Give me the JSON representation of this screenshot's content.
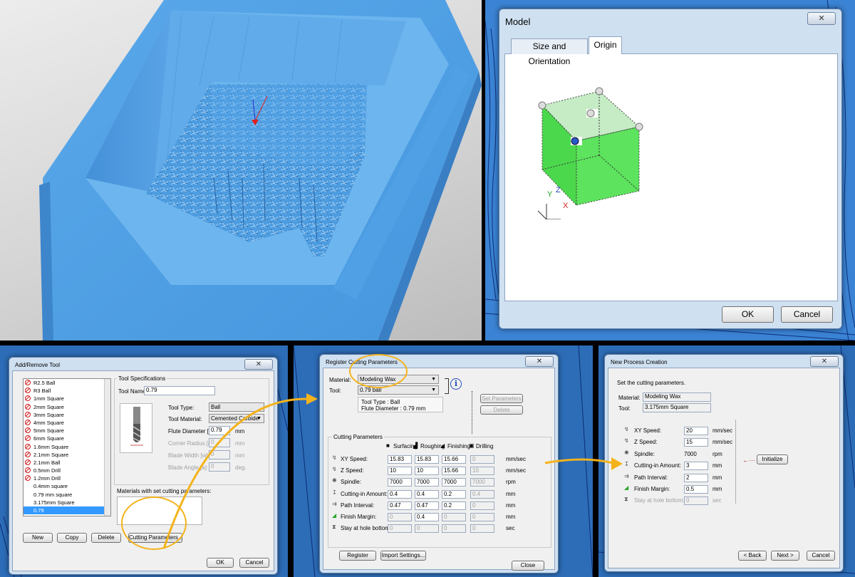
{
  "model_dialog": {
    "title": "Model",
    "close_icon": "✕",
    "tabs": [
      "Size and Orientation",
      "Origin"
    ],
    "axis_labels": {
      "x": "X",
      "y": "Y",
      "z": "Z"
    },
    "ok_label": "OK",
    "cancel_label": "Cancel"
  },
  "add_remove_tool": {
    "title": "Add/Remove Tool",
    "close_icon": "✕",
    "tools": [
      {
        "name": "R2.5 Ball",
        "disabled": true
      },
      {
        "name": "R3 Ball",
        "disabled": true
      },
      {
        "name": "1mm Square",
        "disabled": true
      },
      {
        "name": "2mm Square",
        "disabled": true
      },
      {
        "name": "3mm Square",
        "disabled": true
      },
      {
        "name": "4mm Square",
        "disabled": true
      },
      {
        "name": "5mm Square",
        "disabled": true
      },
      {
        "name": "6mm Square",
        "disabled": true
      },
      {
        "name": "1.6mm Square",
        "disabled": true
      },
      {
        "name": "2.1mm Square",
        "disabled": true
      },
      {
        "name": "2.1mm Ball",
        "disabled": true
      },
      {
        "name": "0.5mm Drill",
        "disabled": true
      },
      {
        "name": "1.2mm Drill",
        "disabled": true
      },
      {
        "name": "0.4mm square",
        "disabled": false
      },
      {
        "name": "0.79 mm square",
        "disabled": false
      },
      {
        "name": "3.175mm Square",
        "disabled": false
      },
      {
        "name": "0.79",
        "disabled": false,
        "selected": true
      }
    ],
    "spec_group": "Tool Specifications",
    "tool_name_label": "Tool Name:",
    "tool_name_value": "0.79",
    "tool_type_label": "Tool Type:",
    "tool_type_value": "Ball",
    "tool_material_label": "Tool Material:",
    "tool_material_value": "Cemented Carbide",
    "flute_diameter_label": "Flute Diameter [d]:",
    "flute_diameter_value": "0.79",
    "corner_radius_label": "Corner Radius [r]:",
    "corner_radius_value": "0",
    "blade_width_label": "Blade Width [w]:",
    "blade_width_value": "0",
    "blade_angle_label": "Blade Angle [a]:",
    "blade_angle_value": "0",
    "unit_mm": "mm",
    "unit_deg": "deg.",
    "materials_label": "Materials with set cutting parameters:",
    "new_label": "New",
    "copy_label": "Copy",
    "delete_label": "Delete",
    "cutting_params_label": "Cutting Parameters...",
    "ok_label": "OK",
    "cancel_label": "Cancel"
  },
  "register_cutting": {
    "title": "Register Cutting Parameters",
    "close_icon": "✕",
    "material_label": "Material:",
    "material_value": "Modeling Wax",
    "tool_label": "Tool:",
    "tool_value": "0.79 ball",
    "info_icon": "i",
    "tool_type_text": "Tool Type : Ball",
    "flute_text": "Flute Diameter : 0.79 mm",
    "set_params_label": "Set Parameters",
    "delete_label": "Delete",
    "group_label": "Cutting Parameters",
    "columns": [
      "Surfacing",
      "Roughing",
      "Finishing",
      "Drilling"
    ],
    "rows": [
      {
        "label": "XY Speed:",
        "values": [
          "15.83",
          "15.83",
          "15.66",
          "0"
        ],
        "disabled": [
          false,
          false,
          false,
          true
        ],
        "unit": "mm/sec"
      },
      {
        "label": "Z Speed:",
        "values": [
          "10",
          "10",
          "15.66",
          "10"
        ],
        "disabled": [
          false,
          false,
          false,
          true
        ],
        "unit": "mm/sec"
      },
      {
        "label": "Spindle:",
        "values": [
          "7000",
          "7000",
          "7000",
          "7000"
        ],
        "disabled": [
          false,
          false,
          false,
          true
        ],
        "unit": "rpm"
      },
      {
        "label": "Cutting-in Amount:",
        "values": [
          "0.4",
          "0.4",
          "0.2",
          "0.4"
        ],
        "disabled": [
          false,
          false,
          false,
          true
        ],
        "unit": "mm"
      },
      {
        "label": "Path Interval:",
        "values": [
          "0.47",
          "0.47",
          "0.2",
          "0"
        ],
        "disabled": [
          false,
          false,
          false,
          true
        ],
        "unit": "mm"
      },
      {
        "label": "Finish Margin:",
        "values": [
          "0",
          "0.4",
          "0",
          "0"
        ],
        "disabled": [
          true,
          false,
          true,
          true
        ],
        "unit": "mm"
      },
      {
        "label": "Stay at hole bottom:",
        "values": [
          "0",
          "0",
          "0",
          "0"
        ],
        "disabled": [
          true,
          true,
          true,
          true
        ],
        "unit": "sec"
      }
    ],
    "register_label": "Register",
    "import_label": "Import Settings...",
    "close_label": "Close"
  },
  "new_process": {
    "title": "New Process Creation",
    "close_icon": "✕",
    "instruction": "Set the cutting parameters.",
    "material_label": "Material:",
    "material_value": "Modeling Wax",
    "tool_label": "Tool:",
    "tool_value": "3.175mm Square",
    "rows": [
      {
        "label": "XY Speed:",
        "value": "20",
        "unit": "mm/sec",
        "disabled": false,
        "plain": false
      },
      {
        "label": "Z Speed:",
        "value": "15",
        "unit": "mm/sec",
        "disabled": false,
        "plain": false
      },
      {
        "label": "Spindle:",
        "value": "7000",
        "unit": "rpm",
        "disabled": false,
        "plain": true
      },
      {
        "label": "Cutting-in Amount:",
        "value": "3",
        "unit": "mm",
        "disabled": false,
        "plain": false
      },
      {
        "label": "Path Interval:",
        "value": "2",
        "unit": "mm",
        "disabled": false,
        "plain": false
      },
      {
        "label": "Finish Margin:",
        "value": "0.5",
        "unit": "mm",
        "disabled": false,
        "plain": false
      },
      {
        "label": "Stay at hole bottom:",
        "value": "0",
        "unit": "sec",
        "disabled": true,
        "plain": false
      }
    ],
    "initialize_label": "Initialize",
    "back_label": "< Back",
    "next_label": "Next >",
    "cancel_label": "Cancel"
  }
}
